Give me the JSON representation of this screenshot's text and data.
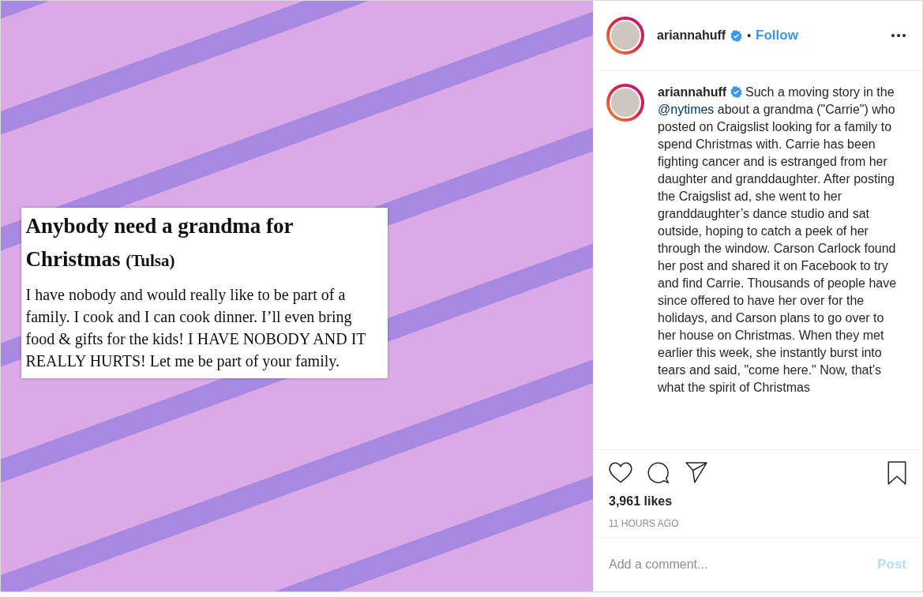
{
  "post_image": {
    "ad": {
      "title": "Anybody need a grandma for Christmas",
      "title_location": "(Tulsa)",
      "body": "I have nobody and would really like to be part of a family. I cook and I can cook dinner. I’ll even bring food & gifts for the kids! I HAVE NOBODY AND IT REALLY HURTS! Let me be part of your family."
    }
  },
  "header": {
    "username": "ariannahuff",
    "verified": true,
    "separator": "•",
    "follow": "Follow"
  },
  "caption": {
    "username": "ariannahuff",
    "verified": true,
    "text_before": "Such a moving story in the ",
    "mention": "@nytimes",
    "text_after": " about a grandma (\"Carrie\") who posted on Craigslist looking for a family to spend Christmas with. Carrie has been fighting cancer and is estranged from her daughter and granddaughter. After posting the Craigslist ad, she went to her granddaughter’s dance studio and sat outside, hoping to catch a peek of her through the window. Carson Carlock found her post and shared it on Facebook to try and find Carrie. Thousands of people have since offered to have her over for the holidays, and Carson plans to go over to her house on Christmas. When they met earlier this week, she instantly burst into tears and said, \"come here.\" Now, that's what the spirit of Christmas"
  },
  "actions": {
    "liked": false,
    "saved": false
  },
  "likes": "3,961 likes",
  "time": "11 HOURS AGO",
  "comment": {
    "placeholder": "Add a comment...",
    "post": "Post",
    "post_disabled": true
  }
}
